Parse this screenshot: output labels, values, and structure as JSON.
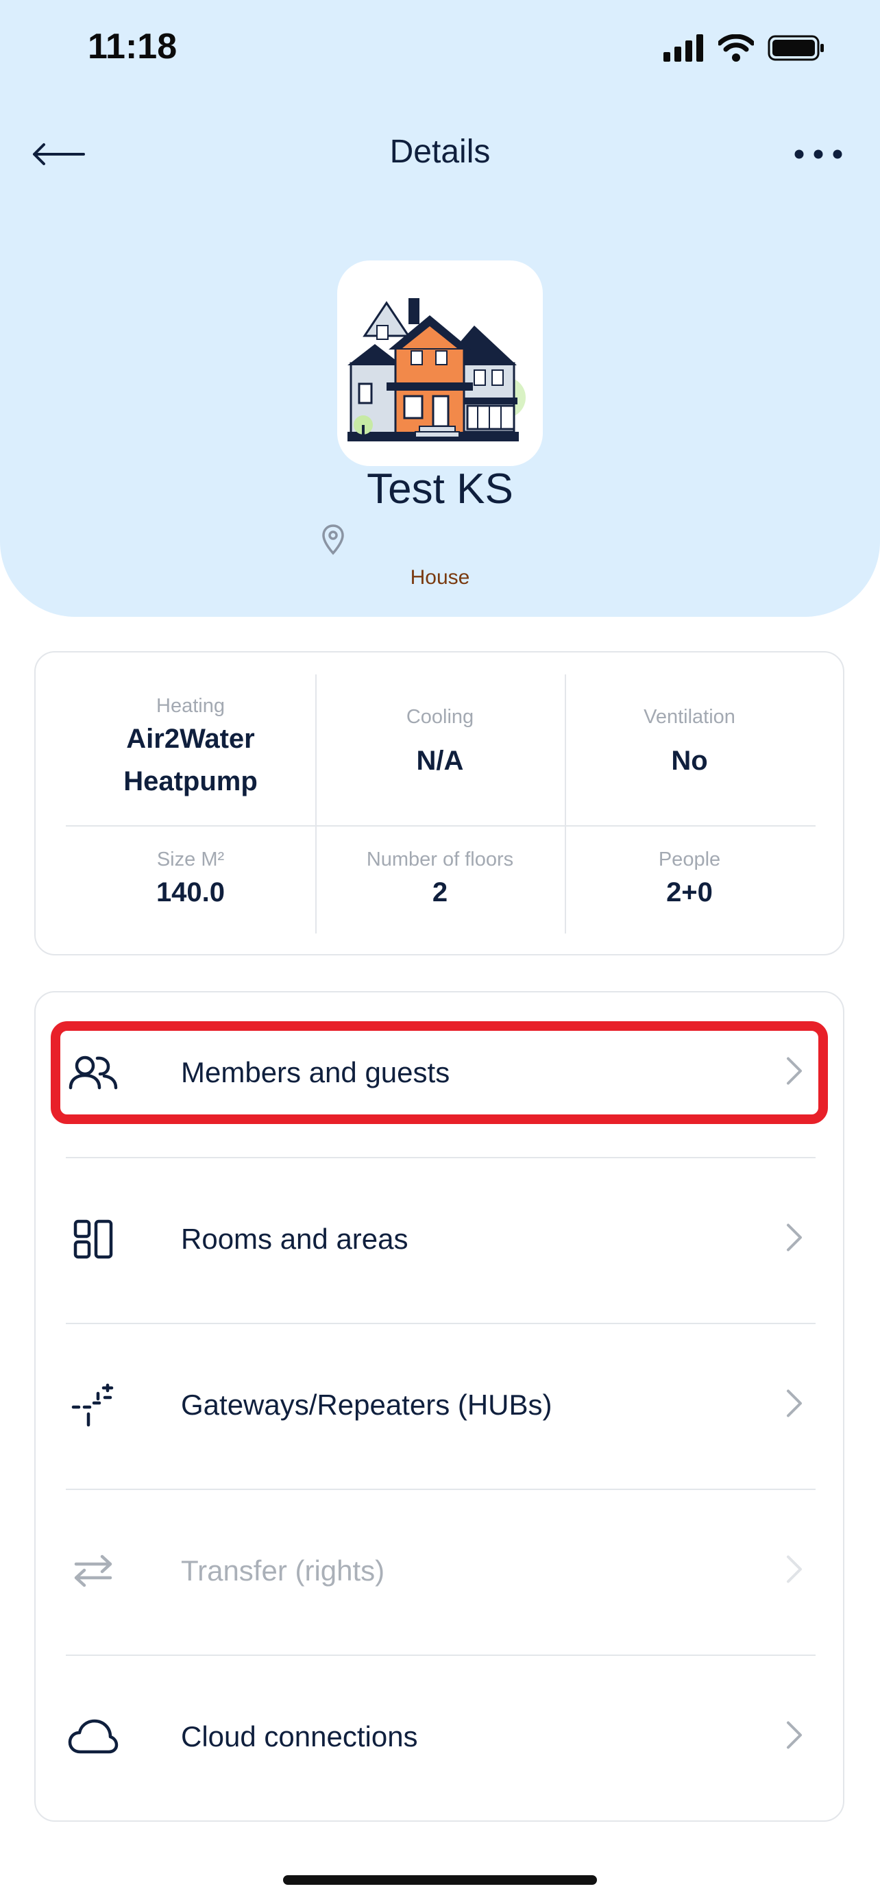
{
  "status_bar": {
    "time": "11:18"
  },
  "nav": {
    "title": "Details"
  },
  "home": {
    "name": "Test KS",
    "type": "House"
  },
  "info": {
    "heating_label": "Heating",
    "heating_value_line1": "Air2Water",
    "heating_value_line2": "Heatpump",
    "cooling_label": "Cooling",
    "cooling_value": "N/A",
    "ventilation_label": "Ventilation",
    "ventilation_value": "No",
    "size_label": "Size M²",
    "size_value": "140.0",
    "floors_label": "Number of floors",
    "floors_value": "2",
    "people_label": "People",
    "people_value": "2+0"
  },
  "menu": {
    "items": [
      {
        "label": "Members and guests",
        "icon": "members-icon",
        "disabled": false,
        "highlighted": true
      },
      {
        "label": "Rooms and areas",
        "icon": "rooms-icon",
        "disabled": false
      },
      {
        "label": "Gateways/Repeaters (HUBs)",
        "icon": "gateway-icon",
        "disabled": false
      },
      {
        "label": "Transfer (rights)",
        "icon": "transfer-icon",
        "disabled": true
      },
      {
        "label": "Cloud connections",
        "icon": "cloud-icon",
        "disabled": false
      }
    ]
  },
  "colors": {
    "header_bg": "#dbeefd",
    "highlight": "#e82029",
    "text": "#0f1f3d",
    "disabled": "#aab0b8"
  }
}
